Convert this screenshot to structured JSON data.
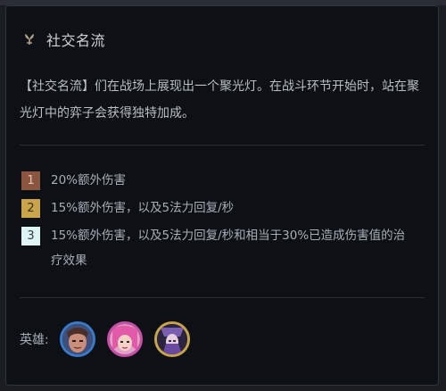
{
  "trait": {
    "icon": "crown-flower-icon",
    "title": "社交名流",
    "description": "【社交名流】们在战场上展现出一个聚光灯。在战斗环节开始时，站在聚光灯中的弈子会获得独特加成。"
  },
  "tiers": [
    {
      "level": "1",
      "text": "20%额外伤害",
      "color": "#8a5640",
      "text_color": "#e7c7b8"
    },
    {
      "level": "2",
      "text": "15%额外伤害，以及5法力回复/秒",
      "color": "#c9a44a",
      "text_color": "#3a2c0a"
    },
    {
      "level": "3",
      "text": "15%额外伤害，以及5法力回复/秒和相当于30%已造成伤害值的治疗效果",
      "color": "#dff3f5",
      "text_color": "#2a3c44"
    }
  ],
  "heroes": {
    "label": "英雄:",
    "items": [
      {
        "name": "hero-1-avatar",
        "border": "#3b79c9"
      },
      {
        "name": "hero-2-avatar",
        "border": "#c94ea8"
      },
      {
        "name": "hero-3-avatar",
        "border": "#c9a44a"
      }
    ]
  }
}
